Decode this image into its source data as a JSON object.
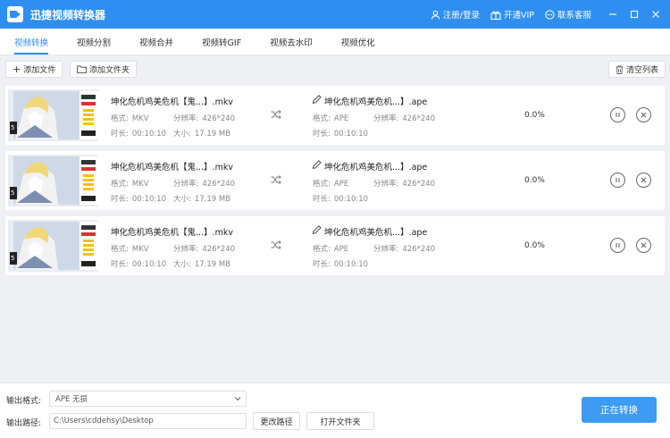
{
  "app": {
    "title": "迅捷视频转换器"
  },
  "titlebar": {
    "login": "注册/登录",
    "vip": "开通VIP",
    "support": "联系客服"
  },
  "tabs": [
    "视频转换",
    "视频分割",
    "视频合并",
    "视频转GIF",
    "视频去水印",
    "视频优化"
  ],
  "toolbar": {
    "add_file": "添加文件",
    "add_folder": "添加文件夹",
    "clear_list": "清空列表"
  },
  "labels": {
    "format": "格式:",
    "resolution": "分辨率:",
    "duration": "时长:",
    "size": "大小:"
  },
  "files": [
    {
      "src_name": "坤化危机鸡美危机【鬼...】.mkv",
      "src_format": "MKV",
      "src_resolution": "426*240",
      "src_duration": "00:10:10",
      "src_size": "17.19 MB",
      "out_name": "坤化危机鸡美危机...】.ape",
      "out_format": "APE",
      "out_resolution": "426*240",
      "out_duration": "00:10:10",
      "progress": "0.0%"
    },
    {
      "src_name": "坤化危机鸡美危机【鬼...】.mkv",
      "src_format": "MKV",
      "src_resolution": "426*240",
      "src_duration": "00:10:10",
      "src_size": "17.19 MB",
      "out_name": "坤化危机鸡美危机...】.ape",
      "out_format": "APE",
      "out_resolution": "426*240",
      "out_duration": "00:10:10",
      "progress": "0.0%"
    },
    {
      "src_name": "坤化危机鸡美危机【鬼...】.mkv",
      "src_format": "MKV",
      "src_resolution": "426*240",
      "src_duration": "00:10:10",
      "src_size": "17.19 MB",
      "out_name": "坤化危机鸡美危机...】.ape",
      "out_format": "APE",
      "out_resolution": "426*240",
      "out_duration": "00:10:10",
      "progress": "0.0%"
    }
  ],
  "bottom": {
    "format_label": "输出格式:",
    "format_value": "APE  无损",
    "path_label": "输出路径:",
    "path_value": "C:\\Users\\cddehsy\\Desktop",
    "change_path": "更改路径",
    "open_folder": "打开文件夹",
    "convert": "正在转换"
  },
  "colors": {
    "accent": "#2f8ff0",
    "primary_button": "#3c9bf2"
  },
  "icons": [
    "logo-icon",
    "user-icon",
    "vip-icon",
    "chat-icon",
    "minimize-icon",
    "maximize-icon",
    "close-icon",
    "plus-icon",
    "folder-icon",
    "trash-icon",
    "shuffle-icon",
    "pencil-icon",
    "pause-icon",
    "remove-icon",
    "chevron-down-icon"
  ]
}
